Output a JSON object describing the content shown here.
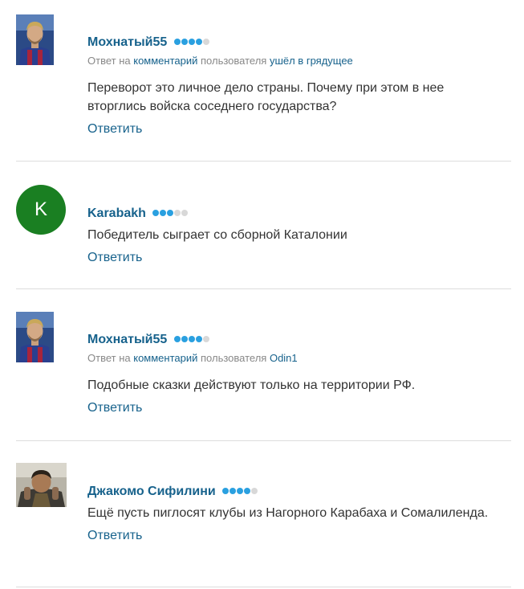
{
  "comments": [
    {
      "author": "Мохнатый55",
      "rating": 4,
      "rating_max": 5,
      "avatar": "photo-soccer-player",
      "reply_prefix": "Ответ на",
      "reply_link": "комментарий",
      "reply_middle": "пользователя",
      "reply_user": "ушёл в грядущее",
      "text": "Переворот это личное дело страны. Почему при этом в нее вторглись войска соседнего государства?",
      "reply_label": "Ответить"
    },
    {
      "author": "Karabakh",
      "rating": 3,
      "rating_max": 5,
      "avatar": "letter-avatar",
      "avatar_letter": "K",
      "avatar_color": "#1a7f22",
      "text": "Победитель сыграет со сборной Каталонии",
      "reply_label": "Ответить"
    },
    {
      "author": "Мохнатый55",
      "rating": 4,
      "rating_max": 5,
      "avatar": "photo-soccer-player",
      "reply_prefix": "Ответ на",
      "reply_link": "комментарий",
      "reply_middle": "пользователя",
      "reply_user": "Odin1",
      "text": "Подобные сказки действуют только на территории РФ.",
      "reply_label": "Ответить"
    },
    {
      "author": "Джакомо Сифилини",
      "rating": 4,
      "rating_max": 5,
      "avatar": "photo-person",
      "text": "Ещё пусть пиглосят клубы из Нагорного Карабаха и Сомалиленда.",
      "reply_label": "Ответить"
    }
  ],
  "colors": {
    "link": "#17628c",
    "rating_on": "#2aa0e0",
    "rating_off": "#d8d8d8",
    "divider": "#dddddd"
  }
}
